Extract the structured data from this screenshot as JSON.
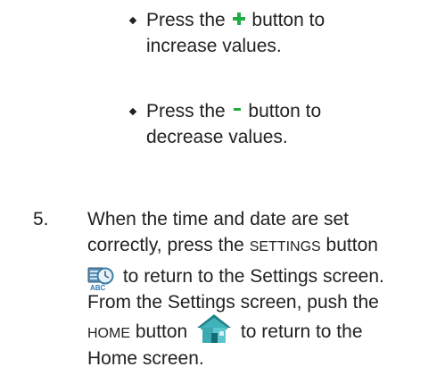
{
  "bullets": [
    {
      "before": "Press the",
      "icon": "plus-icon",
      "after": "button to",
      "line2": "increase values."
    },
    {
      "before": "Press the",
      "icon": "minus-icon",
      "after": "button to",
      "line2": "decrease values."
    }
  ],
  "step": {
    "number": "5.",
    "line1": "When the time and date are set",
    "line2_pre": "correctly, press the",
    "line2_caps": "SETTINGS",
    "line2_post": "button",
    "line3_icon": "settings-icon",
    "line3_post": "to return to the Settings screen.",
    "line4": "From the Settings screen, push the",
    "line5_caps": "HOME",
    "line5_mid": "button",
    "line5_icon": "home-icon",
    "line5_post": "to return to the",
    "line6": "Home screen."
  },
  "colors": {
    "accent_green": "#1fae42",
    "text": "#222222",
    "house_teal": "#2e9ea6"
  }
}
